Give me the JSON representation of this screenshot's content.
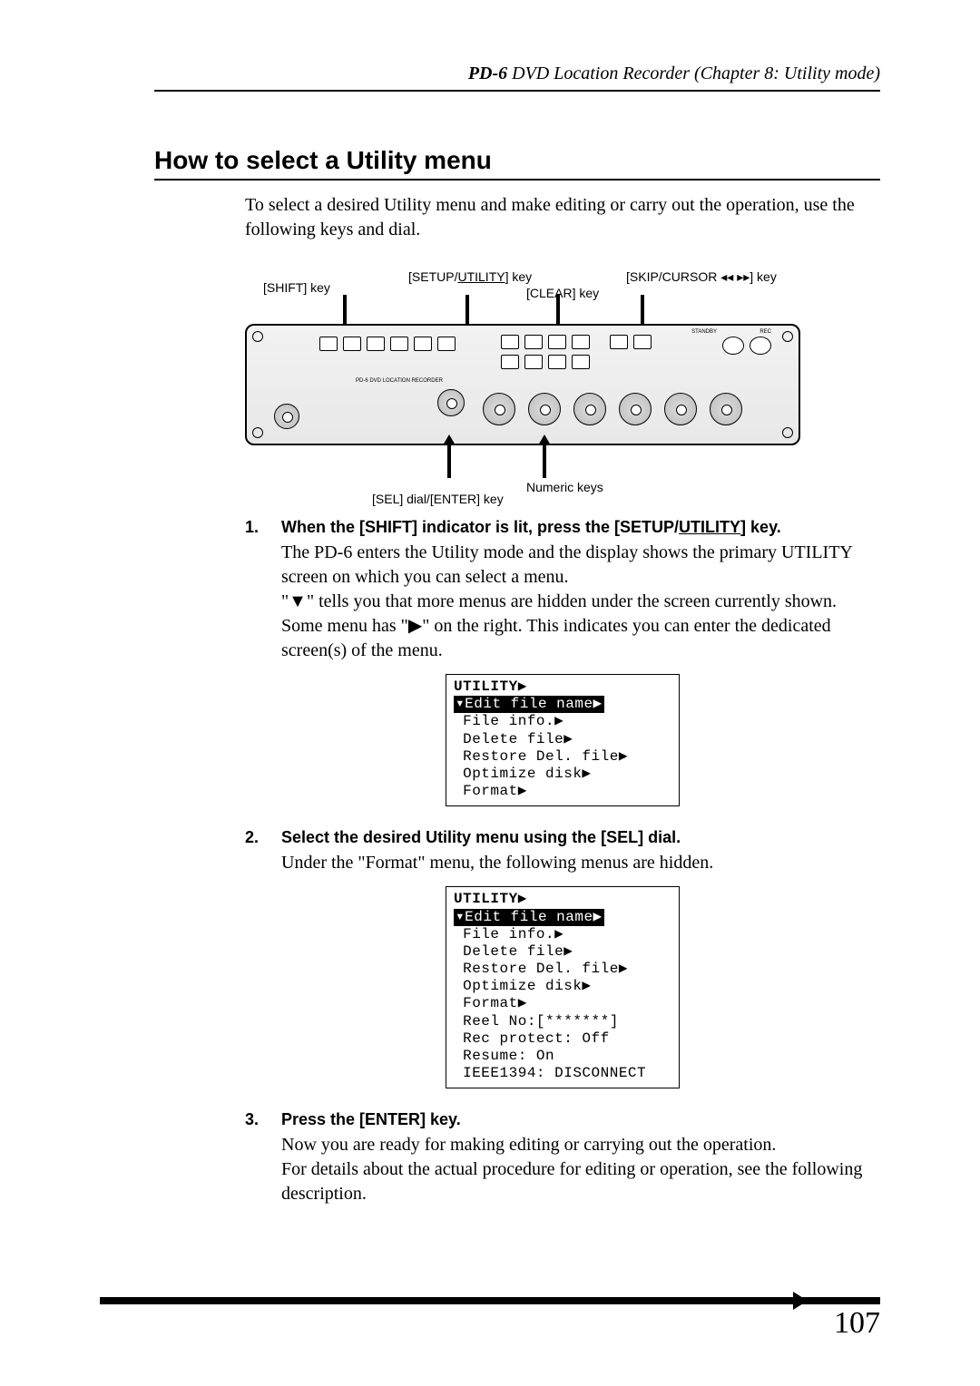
{
  "header": {
    "product": "PD-6",
    "title_rest": " DVD Location Recorder (Chapter 8: Utility mode)"
  },
  "section_title": "How to select a Utility menu",
  "intro": "To select a desired Utility menu and make editing or carry out the operation, use the following keys and dial.",
  "diagram_labels": {
    "shift": "[SHIFT] key",
    "setup": "[SETUP/",
    "setup_u": "UTILITY",
    "setup_end": "] key",
    "clear": "[CLEAR] key",
    "skip_pre": "[SKIP/CURSOR ",
    "skip_post": "] key",
    "numeric": "Numeric keys",
    "sel": "[SEL] dial/[ENTER] key"
  },
  "panel_text": {
    "title": "PD-6 DVD LOCATION RECORDER",
    "standby": "STANDBY",
    "rec": "REC"
  },
  "steps": [
    {
      "num": "1.",
      "head_pre": "When the [SHIFT] indicator is lit, press the [SETUP/",
      "head_u": "UTILITY",
      "head_post": "] key.",
      "body": "The PD-6 enters the Utility mode and the display shows the primary UTILITY screen on which you can select a menu.\n\"▼\" tells you that more menus are hidden under the screen currently shown. Some menu has \"▶\" on the right. This indicates you can enter the dedicated screen(s) of the menu."
    },
    {
      "num": "2.",
      "head": "Select the desired Utility menu using the [SEL] dial.",
      "body": "Under the \"Format\" menu, the following menus are hidden."
    },
    {
      "num": "3.",
      "head": "Press the [ENTER] key.",
      "body": "Now you are ready for making editing or carrying out the operation.\nFor details about the actual procedure for editing or operation, see the following description."
    }
  ],
  "lcd1": {
    "header": "UTILITY▶",
    "highlight": "▾Edit file name▶",
    "rows": [
      " File info.▶",
      " Delete file▶",
      " Restore Del. file▶",
      " Optimize disk▶",
      " Format▶"
    ]
  },
  "lcd2": {
    "header": "UTILITY▶",
    "highlight": "▾Edit file name▶",
    "rows": [
      " File info.▶",
      " Delete file▶",
      " Restore Del. file▶",
      " Optimize disk▶",
      " Format▶",
      " Reel No:[*******]",
      " Rec protect: Off",
      " Resume: On",
      " IEEE1394: DISCONNECT"
    ]
  },
  "page_number": "107"
}
